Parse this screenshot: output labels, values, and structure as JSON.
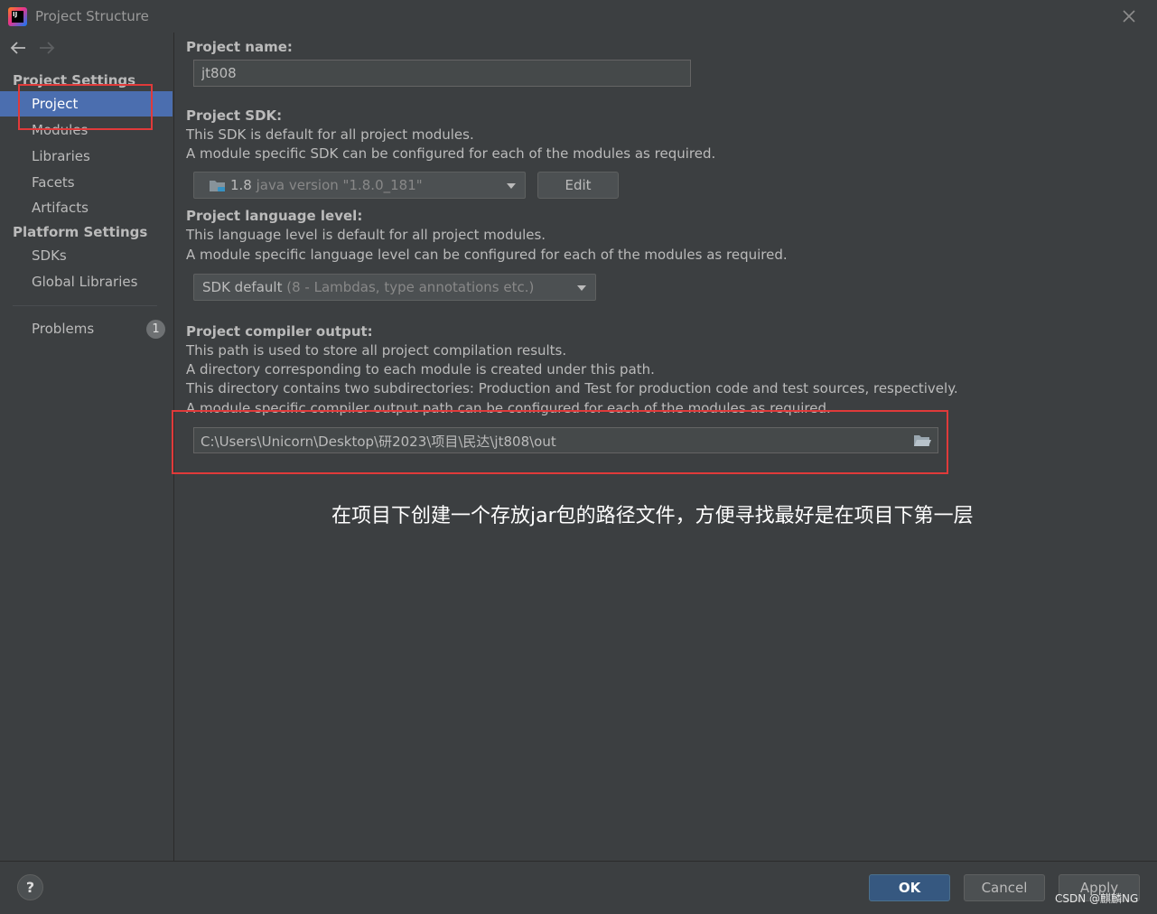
{
  "window": {
    "title": "Project Structure",
    "logo_text": "IJ"
  },
  "sidebar": {
    "project_settings_header": "Project Settings",
    "project_items": [
      {
        "label": "Project",
        "selected": true
      },
      {
        "label": "Modules"
      },
      {
        "label": "Libraries"
      },
      {
        "label": "Facets"
      },
      {
        "label": "Artifacts"
      }
    ],
    "platform_settings_header": "Platform Settings",
    "platform_items": [
      {
        "label": "SDKs"
      },
      {
        "label": "Global Libraries"
      }
    ],
    "problems": {
      "label": "Problems",
      "count": "1"
    }
  },
  "project_name": {
    "label": "Project name:",
    "value": "jt808"
  },
  "project_sdk": {
    "label": "Project SDK:",
    "desc1": "This SDK is default for all project modules.",
    "desc2": "A module specific SDK can be configured for each of the modules as required.",
    "selected_version": "1.8",
    "selected_detail": "java version \"1.8.0_181\"",
    "edit_label": "Edit"
  },
  "language_level": {
    "label": "Project language level:",
    "desc1": "This language level is default for all project modules.",
    "desc2": "A module specific language level can be configured for each of the modules as required.",
    "selected_main": "SDK default",
    "selected_detail": "(8 - Lambdas, type annotations etc.)"
  },
  "compiler_output": {
    "label": "Project compiler output:",
    "desc1": "This path is used to store all project compilation results.",
    "desc2": "A directory corresponding to each module is created under this path.",
    "desc3": "This directory contains two subdirectories: Production and Test for production code and test sources, respectively.",
    "desc4": "A module specific compiler output path can be configured for each of the modules as required.",
    "path": "C:\\Users\\Unicorn\\Desktop\\研2023\\项目\\民达\\jt808\\out"
  },
  "annotation": "在项目下创建一个存放jar包的路径文件，方便寻找最好是在项目下第一层",
  "footer": {
    "help_label": "?",
    "ok_label": "OK",
    "cancel_label": "Cancel",
    "apply_label": "Apply",
    "watermark": "CSDN @麒麟NG"
  },
  "colors": {
    "selection": "#4b6eaf",
    "annotation_box": "#e03a3a",
    "ok_button": "#365880"
  }
}
